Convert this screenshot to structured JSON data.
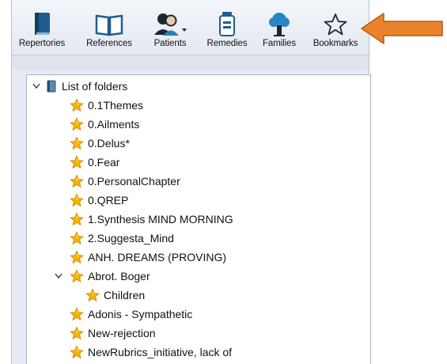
{
  "toolbar": {
    "buttons": [
      {
        "label": "Repertories",
        "icon": "book-icon"
      },
      {
        "label": "References",
        "icon": "open-book-icon"
      },
      {
        "label": "Patients",
        "icon": "patients-icon"
      },
      {
        "label": "Remedies",
        "icon": "remedy-jar-icon"
      },
      {
        "label": "Families",
        "icon": "tree-icon"
      },
      {
        "label": "Bookmarks",
        "icon": "star-outline-icon"
      }
    ]
  },
  "tree": {
    "root": {
      "label": "List of folders",
      "expanded": true
    },
    "items": [
      {
        "label": "0.1Themes",
        "level": 1
      },
      {
        "label": "0.Ailments",
        "level": 1
      },
      {
        "label": "0.Delus*",
        "level": 1
      },
      {
        "label": "0.Fear",
        "level": 1
      },
      {
        "label": "0.PersonalChapter",
        "level": 1
      },
      {
        "label": "0.QREP",
        "level": 1
      },
      {
        "label": "1.Synthesis MIND MORNING",
        "level": 1
      },
      {
        "label": "2.Suggesta_Mind",
        "level": 1
      },
      {
        "label": "ANH. DREAMS (PROVING)",
        "level": 1
      },
      {
        "label": "Abrot. Boger",
        "level": 1,
        "expanded": true
      },
      {
        "label": "Children",
        "level": 2
      },
      {
        "label": "Adonis - Sympathetic",
        "level": 1
      },
      {
        "label": "New-rejection",
        "level": 1
      },
      {
        "label": "NewRubrics_initiative, lack of",
        "level": 1
      }
    ]
  },
  "colors": {
    "star": "#f5b400",
    "arrow": "#e9822b",
    "icon_blue": "#1e5d8e",
    "selection_border": "#a6b1c2"
  }
}
